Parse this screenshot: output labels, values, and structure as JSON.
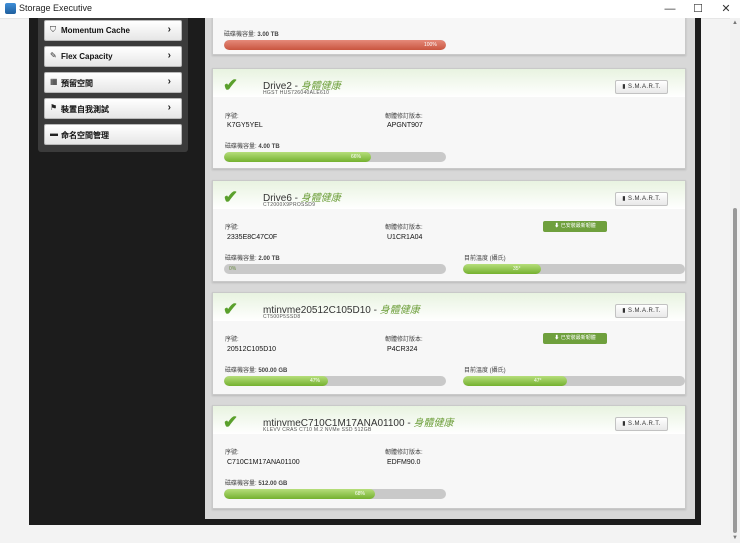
{
  "window": {
    "title": "Storage Executive",
    "minimize": "—",
    "maximize": "☐",
    "close": "✕"
  },
  "sidebar": {
    "items": [
      {
        "label": "Momentum Cache",
        "icon": "funnel-icon",
        "glyph": "⛉",
        "arrow": "›"
      },
      {
        "label": "Flex Capacity",
        "icon": "wrench-icon",
        "glyph": "✎",
        "arrow": "›"
      },
      {
        "label": "預留空間",
        "icon": "grid-icon",
        "glyph": "▦",
        "arrow": "›"
      },
      {
        "label": "裝置自我測試",
        "icon": "flag-icon",
        "glyph": "⚑",
        "arrow": "›"
      },
      {
        "label": "命名空間管理",
        "icon": "drive-icon",
        "glyph": "▬"
      }
    ]
  },
  "common": {
    "capacity_label": "磁碟機容量:",
    "serial_label": "序號:",
    "firmware_label": "韌體修訂版本:",
    "temp_label": "目前溫度 (攝氏)",
    "smart_label": "S.M.A.R.T.",
    "health_status": "身體健康",
    "firmware_latest": "已安裝最新韌體",
    "checkmark": "✔"
  },
  "drives": [
    {
      "capacity": "3.00 TB",
      "capacity_percent_text": "100%",
      "capacity_percent": 100
    },
    {
      "name": "Drive2",
      "model": "HGST HUS726040ALE610",
      "serial": "K7GY5YEL",
      "firmware": "APGNT907",
      "capacity": "4.00 TB",
      "capacity_percent_text": "66%",
      "capacity_percent": 66
    },
    {
      "name": "Drive6",
      "model": "CT2000X9PROSSD9",
      "serial": "2335E8C47C0F",
      "firmware": "U1CR1A04",
      "capacity": "2.00 TB",
      "capacity_percent_text": "0%",
      "capacity_percent": 0,
      "temp_text": "35°",
      "temp_percent": 35
    },
    {
      "name": "mtinvme20512C105D10",
      "model": "CT500P5SSD8",
      "serial": "20512C105D10",
      "firmware": "P4CR324",
      "capacity": "500.00 GB",
      "capacity_percent_text": "47%",
      "capacity_percent": 47,
      "temp_text": "47°",
      "temp_percent": 47
    },
    {
      "name": "mtinvmeC710C1M17ANA01100",
      "model": "KLEVV CRAS C710 M.2 NVMe SSD 512GB",
      "serial": "C710C1M17ANA01100",
      "firmware": "EDFM90.0",
      "capacity": "512.00 GB",
      "capacity_percent_text": "68%",
      "capacity_percent": 68
    }
  ]
}
